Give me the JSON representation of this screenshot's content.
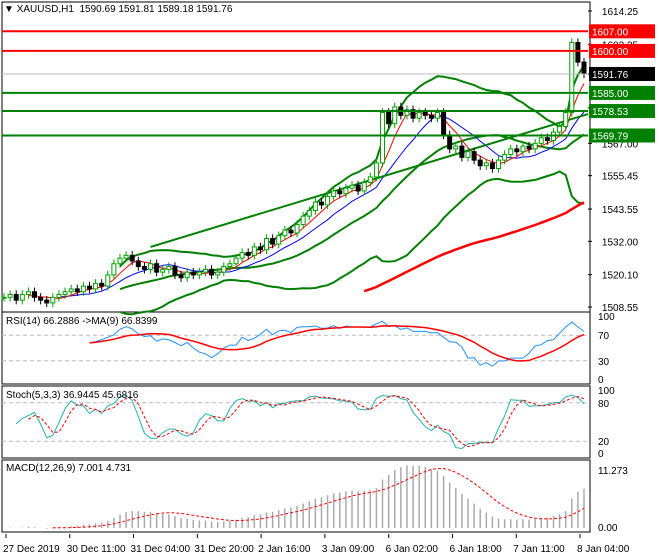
{
  "header": {
    "symbol": "XAUUSD,H1",
    "ohlc": "1590.69 1591.81 1589.18 1591.76"
  },
  "colors": {
    "bull": "#00A000",
    "bear": "#000000",
    "band": "#008000",
    "ma_red": "#FF0000",
    "ma_blue": "#0000FF",
    "rsi": "#1E90FF",
    "stoch": "#20B2AA",
    "resistance": "#FF0000",
    "support": "#008000"
  },
  "chart_data": [
    {
      "type": "candlestick",
      "title": "XAUUSD,H1",
      "ylim": [
        1508.55,
        1614.25
      ],
      "yticks": [
        "1614.25",
        "1602.35",
        "1591.76",
        "1579.65",
        "1567.00",
        "1555.45",
        "1543.55",
        "1532.00",
        "1520.10",
        "1508.55"
      ],
      "xticks": [
        "27 Dec 2019",
        "30 Dec 11:00",
        "31 Dec 04:00",
        "31 Dec 20:00",
        "2 Jan 16:00",
        "3 Jan 09:00",
        "6 Jan 02:00",
        "6 Jan 18:00",
        "7 Jan 11:00",
        "8 Jan 04:00"
      ],
      "closes": [
        1512,
        1513,
        1511,
        1513,
        1514,
        1512,
        1511,
        1510,
        1512,
        1513,
        1514,
        1515,
        1514,
        1516,
        1515,
        1517,
        1516,
        1520,
        1524,
        1526,
        1527,
        1525,
        1523,
        1522,
        1524,
        1521,
        1522,
        1523,
        1520,
        1519,
        1521,
        1520,
        1521,
        1522,
        1520,
        1521,
        1523,
        1524,
        1526,
        1528,
        1527,
        1530,
        1529,
        1533,
        1531,
        1534,
        1536,
        1535,
        1538,
        1541,
        1543,
        1546,
        1545,
        1548,
        1550,
        1549,
        1551,
        1552,
        1550,
        1553,
        1555,
        1560,
        1578,
        1574,
        1580,
        1577,
        1579,
        1576,
        1578,
        1577,
        1576,
        1578,
        1570,
        1565,
        1566,
        1562,
        1564,
        1561,
        1559,
        1560,
        1558,
        1561,
        1563,
        1565,
        1564,
        1566,
        1565,
        1567,
        1569,
        1568,
        1571,
        1573,
        1578,
        1603,
        1596,
        1591.76
      ],
      "current_price": "1591.76",
      "levels": [
        {
          "value": 1607.0,
          "label": "1607.00",
          "kind": "resistance"
        },
        {
          "value": 1600.0,
          "label": "1600.00",
          "kind": "resistance"
        },
        {
          "value": 1585.0,
          "label": "1585.00",
          "kind": "support"
        },
        {
          "value": 1578.53,
          "label": "1578.53",
          "kind": "support"
        },
        {
          "value": 1569.79,
          "label": "1569.79",
          "kind": "support"
        }
      ],
      "trendline": [
        [
          24,
          1530
        ],
        [
          95,
          1577
        ]
      ]
    },
    {
      "type": "line",
      "title": "RSI(14) 66.2886  ->MA(9) 66.8399",
      "ylim": [
        0,
        100
      ],
      "yticks": [
        "100",
        "70",
        "30",
        "0"
      ],
      "levels": [
        70,
        30
      ]
    },
    {
      "type": "line",
      "title": "Stoch(5,3,3) 36.9445 45.6816",
      "ylim": [
        0,
        100
      ],
      "yticks": [
        "100",
        "80",
        "20",
        "0"
      ],
      "levels": [
        80,
        20
      ]
    },
    {
      "type": "bar",
      "title": "MACD(12,26,9) 7.001 4.731",
      "yticks": [
        "11.273",
        "0.00"
      ],
      "ylim": [
        0,
        11.273
      ]
    }
  ]
}
